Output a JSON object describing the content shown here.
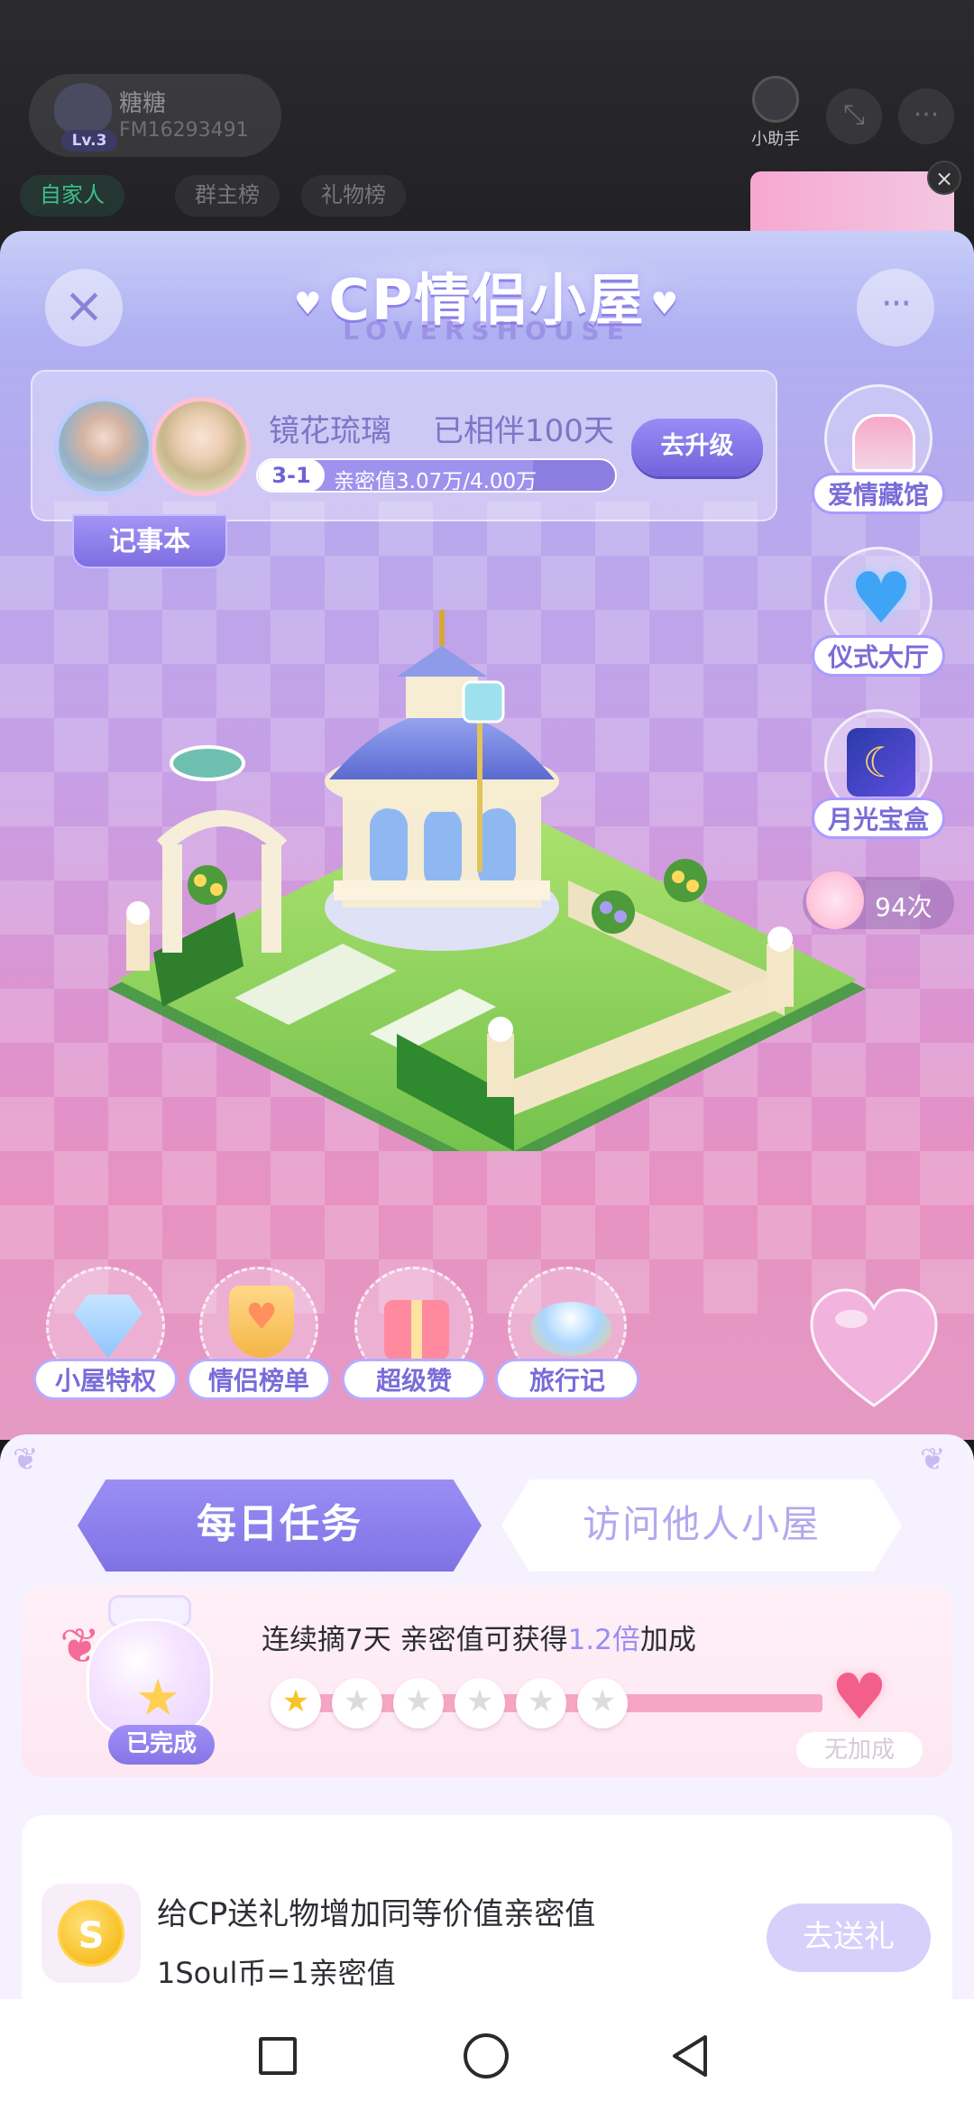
{
  "room": {
    "host_name": "糖糖",
    "host_level": "Lv.3",
    "host_id": "FM16293491",
    "assistant_label": "小助手",
    "tabs": [
      "自家人",
      "群主榜",
      "礼物榜"
    ],
    "banner_close": "×"
  },
  "panel": {
    "title": "CP情侣小屋",
    "subtitle": "LOVERSHOUSE",
    "close_icon": "×",
    "more_icon": "···",
    "couple_name": "镜花琉璃",
    "days_together": "已相伴100天",
    "level_badge": "3-1",
    "intimacy_text": "亲密值3.07万/4.00万",
    "intimacy_progress": 0.77,
    "upgrade_label": "去升级",
    "notebook_label": "记事本",
    "side_features": [
      "爱情藏馆",
      "仪式大厅",
      "月光宝盒"
    ],
    "likes_count": "94次",
    "quick_entries": [
      "小屋特权",
      "情侣榜单",
      "超级赞",
      "旅行记"
    ]
  },
  "sheet": {
    "tab_daily": "每日任务",
    "tab_visit": "访问他人小屋",
    "task1": {
      "text_prefix": "连续摘7天 亲密值可获得",
      "multiplier": "1.2倍",
      "text_suffix": "加成",
      "done_badge": "已完成",
      "no_bonus": "无加成",
      "days_total": 7,
      "days_done": 1
    },
    "task2": {
      "title": "给CP送礼物增加同等价值亲密值",
      "sub": "1Soul币=1亲密值",
      "coin_symbol": "S",
      "button": "去送礼"
    }
  },
  "colors": {
    "accent": "#7f72e4",
    "panel_top": "#aab4f4",
    "panel_bottom": "#e592c2",
    "pink_track": "#f6a6c3"
  }
}
